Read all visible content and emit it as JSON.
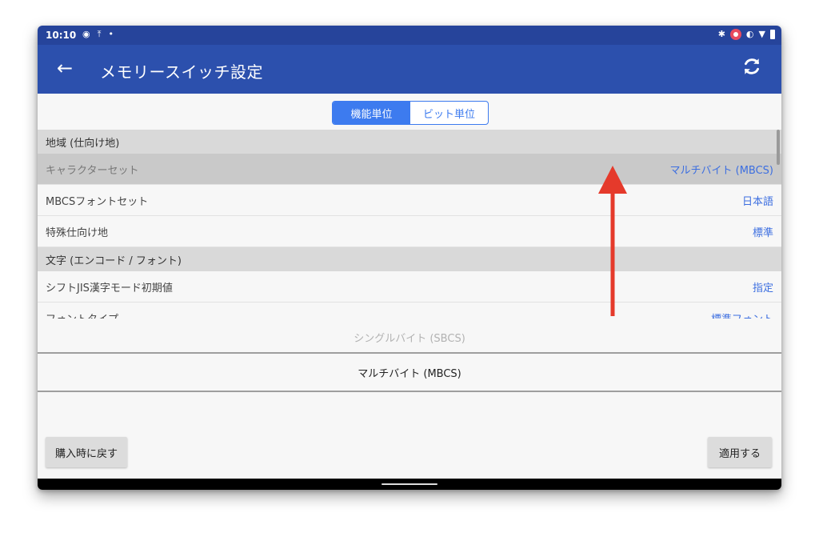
{
  "status_bar": {
    "time": "10:10",
    "left_icons": [
      "target-icon",
      "upload-icon",
      "dot-icon"
    ],
    "right_icons": [
      "bluetooth-icon",
      "notification-badge-icon",
      "vibrate-icon",
      "wifi-icon",
      "battery-icon"
    ]
  },
  "app_bar": {
    "title": "メモリースイッチ設定",
    "back_icon": "←",
    "color": "#2c50ad"
  },
  "segment": {
    "options": [
      "機能単位",
      "ビット単位"
    ],
    "selected": "機能単位",
    "accent": "#3d7bef"
  },
  "list": {
    "section1": {
      "header": "地域 (仕向け地)"
    },
    "rows1": [
      {
        "label": "キャラクターセット",
        "value": "マルチバイト (MBCS)"
      },
      {
        "label": "MBCSフォントセット",
        "value": "日本語"
      },
      {
        "label": "特殊仕向け地",
        "value": "標準"
      }
    ],
    "section2": {
      "header": "文字 (エンコード / フォント)"
    },
    "rows2": [
      {
        "label": "シフトJIS漢字モード初期値",
        "value": "指定"
      },
      {
        "label": "フォントタイプ",
        "value": "標準フォント"
      }
    ]
  },
  "picker": {
    "option_above": "シングルバイト (SBCS)",
    "option_selected": "マルチバイト (MBCS)"
  },
  "buttons": {
    "reset": "購入時に戻す",
    "apply": "適用する"
  },
  "annotation": {
    "arrow_color": "#e53a2b",
    "direction": "up"
  }
}
